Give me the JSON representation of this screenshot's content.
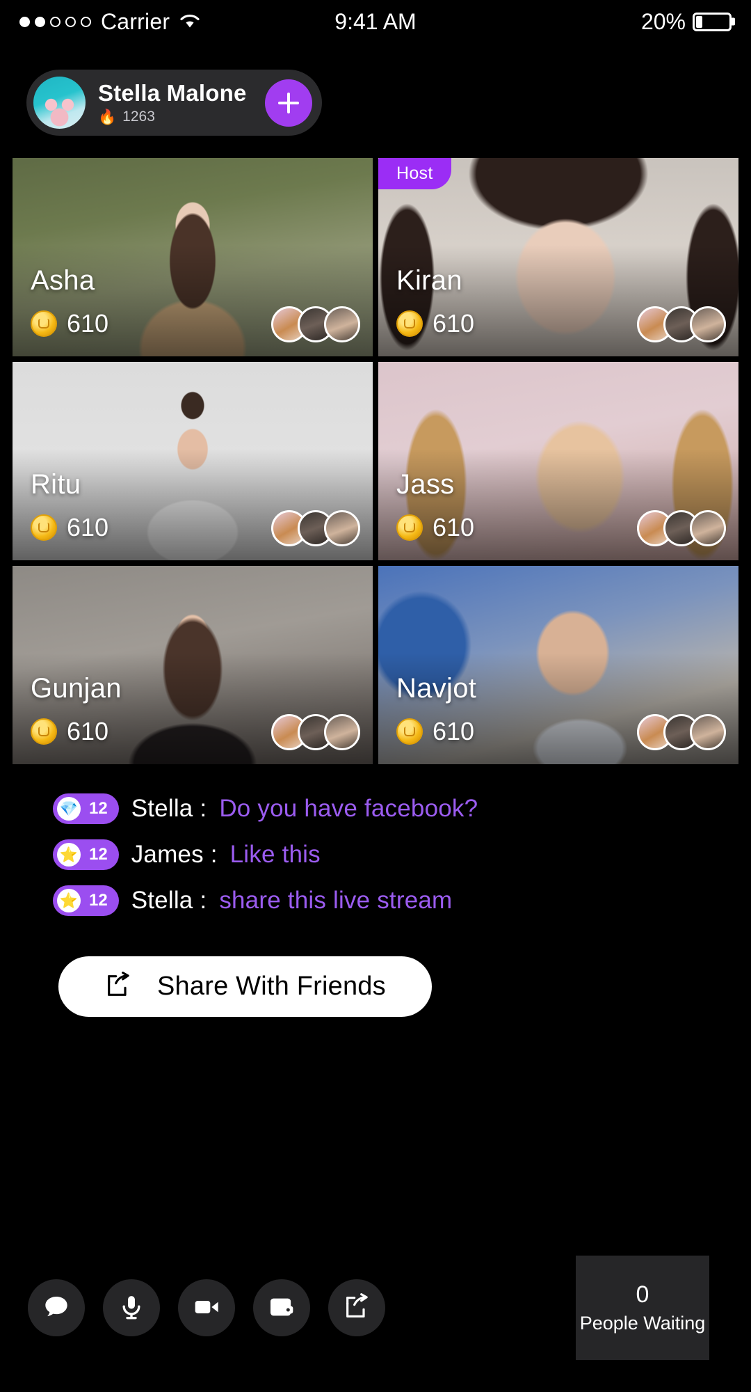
{
  "status_bar": {
    "carrier": "Carrier",
    "signal_dots": [
      true,
      true,
      false,
      false,
      false
    ],
    "wifi_icon": "wifi-icon",
    "time": "9:41 AM",
    "battery_percent": "20%",
    "battery_level": 20
  },
  "host_bar": {
    "avatar": "host-avatar",
    "name": "Stella Malone",
    "flame_icon": "flame-icon",
    "score": "1263",
    "add_button_icon": "plus-icon"
  },
  "grid": {
    "host_badge_label": "Host",
    "cards": [
      {
        "name": "Asha",
        "coins": "610",
        "is_host": false,
        "photo_class": "ph-asha"
      },
      {
        "name": "Kiran",
        "coins": "610",
        "is_host": true,
        "photo_class": "ph-kiran"
      },
      {
        "name": "Ritu",
        "coins": "610",
        "is_host": false,
        "photo_class": "ph-ritu"
      },
      {
        "name": "Jass",
        "coins": "610",
        "is_host": false,
        "photo_class": "ph-jass"
      },
      {
        "name": "Gunjan",
        "coins": "610",
        "is_host": false,
        "photo_class": "ph-gunjan"
      },
      {
        "name": "Navjot",
        "coins": "610",
        "is_host": false,
        "photo_class": "ph-navjot"
      }
    ]
  },
  "chat": {
    "messages": [
      {
        "gift_icon": "gem-icon",
        "gift_glyph": "💎",
        "count": "12",
        "user": "Stella :",
        "text": "Do you have facebook?"
      },
      {
        "gift_icon": "star-icon",
        "gift_glyph": "⭐",
        "count": "12",
        "user": "James :",
        "text": "Like this"
      },
      {
        "gift_icon": "star-icon",
        "gift_glyph": "⭐",
        "count": "12",
        "user": "Stella :",
        "text": "share this live stream"
      }
    ]
  },
  "share_button": {
    "icon": "share-icon",
    "label": "Share With Friends"
  },
  "bottom_bar": {
    "tools": [
      {
        "icon": "chat-bubble-icon"
      },
      {
        "icon": "microphone-icon"
      },
      {
        "icon": "video-camera-icon"
      },
      {
        "icon": "wallet-icon"
      },
      {
        "icon": "share-icon"
      }
    ],
    "waiting": {
      "count": "0",
      "label": "People Waiting"
    }
  },
  "colors": {
    "background": "#000000",
    "accent_purple": "#9b2df5",
    "chat_text_purple": "#9b5cf0",
    "panel_gray": "#262628",
    "pill_gray": "#2b2b2d",
    "coin_gold": "#f5b915"
  }
}
